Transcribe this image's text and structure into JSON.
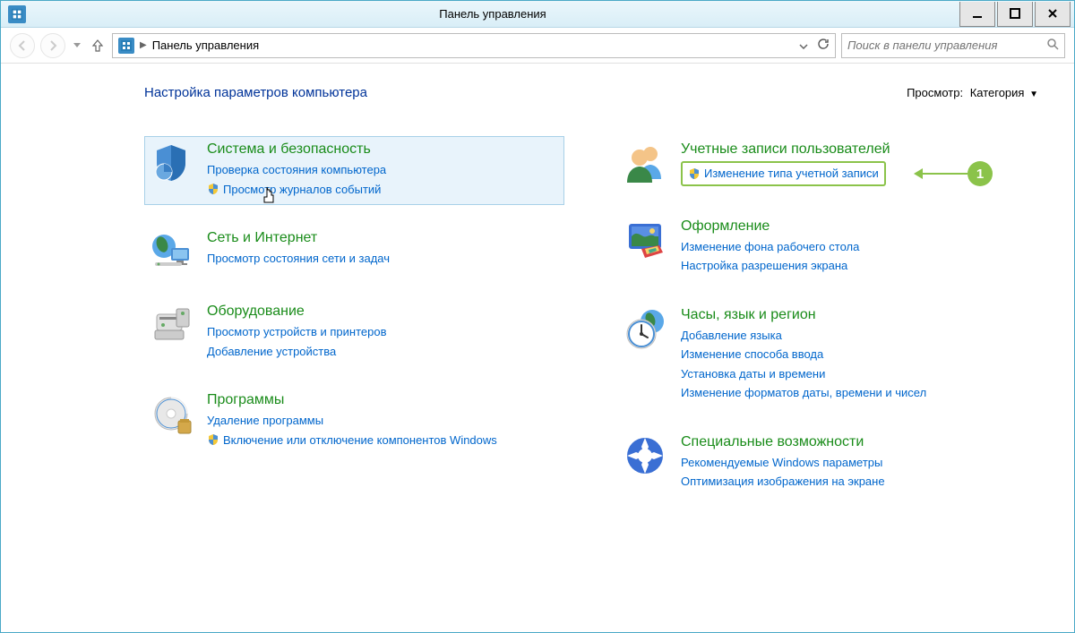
{
  "window": {
    "title": "Панель управления"
  },
  "address": {
    "location": "Панель управления"
  },
  "search": {
    "placeholder": "Поиск в панели управления"
  },
  "header": {
    "title": "Настройка параметров компьютера",
    "view_label": "Просмотр:",
    "view_value": "Категория"
  },
  "left": [
    {
      "title": "Система и безопасность",
      "links": [
        {
          "text": "Проверка состояния компьютера",
          "shield": false
        },
        {
          "text": "Просмотр журналов событий",
          "shield": true
        }
      ],
      "hover": true
    },
    {
      "title": "Сеть и Интернет",
      "links": [
        {
          "text": "Просмотр состояния сети и задач",
          "shield": false
        }
      ]
    },
    {
      "title": "Оборудование",
      "links": [
        {
          "text": "Просмотр устройств и принтеров",
          "shield": false
        },
        {
          "text": "Добавление устройства",
          "shield": false
        }
      ]
    },
    {
      "title": "Программы",
      "links": [
        {
          "text": "Удаление программы",
          "shield": false
        },
        {
          "text": "Включение или отключение компонентов Windows",
          "shield": true
        }
      ]
    }
  ],
  "right": [
    {
      "title": "Учетные записи пользователей",
      "links": [
        {
          "text": "Изменение типа учетной записи",
          "shield": true,
          "highlight": true
        }
      ],
      "callout": "1"
    },
    {
      "title": "Оформление",
      "links": [
        {
          "text": "Изменение фона рабочего стола",
          "shield": false
        },
        {
          "text": "Настройка разрешения экрана",
          "shield": false
        }
      ]
    },
    {
      "title": "Часы, язык и регион",
      "links": [
        {
          "text": "Добавление языка",
          "shield": false
        },
        {
          "text": "Изменение способа ввода",
          "shield": false
        },
        {
          "text": "Установка даты и времени",
          "shield": false
        },
        {
          "text": "Изменение форматов даты, времени и чисел",
          "shield": false
        }
      ]
    },
    {
      "title": "Специальные возможности",
      "links": [
        {
          "text": "Рекомендуемые Windows параметры",
          "shield": false
        },
        {
          "text": "Оптимизация изображения на экране",
          "shield": false
        }
      ]
    }
  ]
}
